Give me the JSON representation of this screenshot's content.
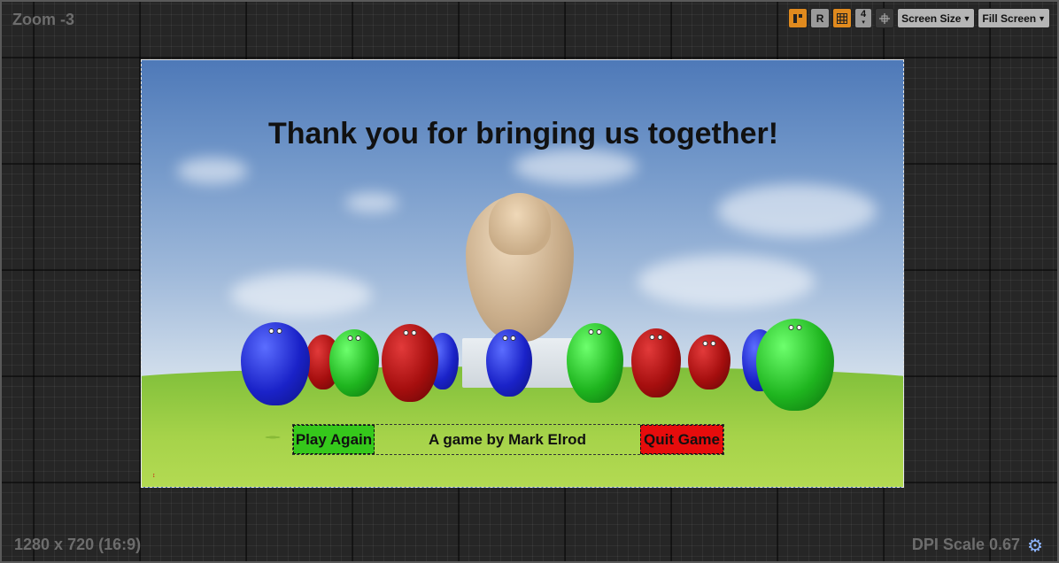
{
  "designer": {
    "zoom_label": "Zoom -3",
    "resolution_label": "1280 x 720 (16:9)",
    "dpi_label": "DPI Scale 0.67"
  },
  "toolbar": {
    "respect_locks_icon": "layout-icon",
    "r_label": "R",
    "grid_snap_icon": "grid-icon",
    "grid_snap_value": "4",
    "transform_icon": "move-icon",
    "screen_size_label": "Screen Size",
    "fill_screen_label": "Fill Screen"
  },
  "widget": {
    "title": "Thank you for bringing us together!",
    "play_again_label": "Play Again",
    "credit": "A game by Mark Elrod",
    "quit_label": "Quit Game"
  },
  "colors": {
    "play_again": "#35c81b",
    "quit_game": "#e60c0c",
    "toolbar_active": "#e08a1e"
  }
}
